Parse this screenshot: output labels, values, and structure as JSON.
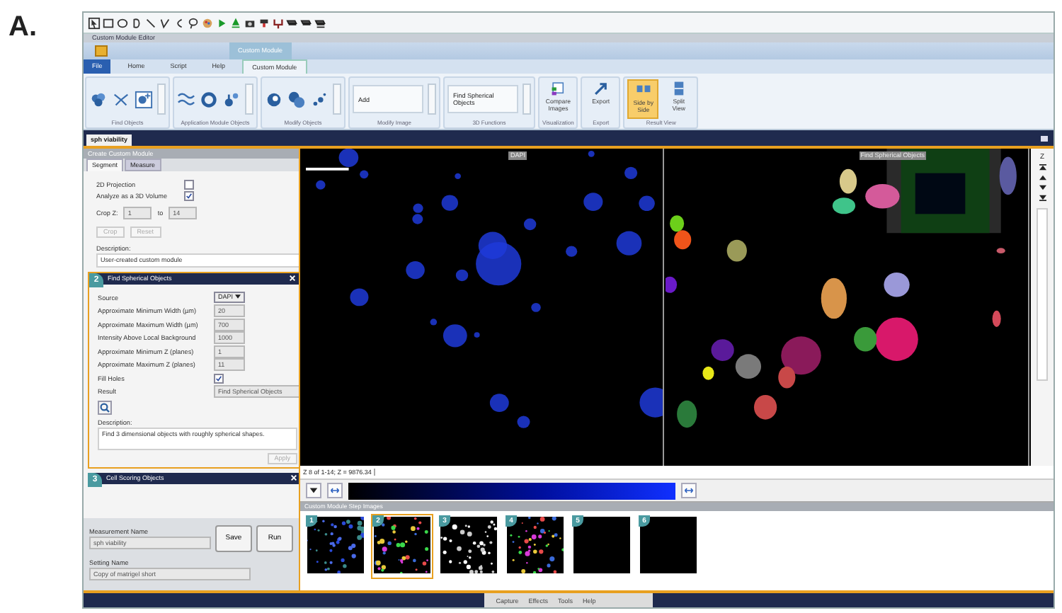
{
  "figure_label": "A.",
  "window": {
    "title": "Custom Module Editor"
  },
  "contextual_tab": {
    "label": "Custom Module"
  },
  "ribbon_tabs": [
    {
      "label": "File",
      "kind": "file",
      "selected": false
    },
    {
      "label": "Home",
      "kind": "tab",
      "selected": false
    },
    {
      "label": "Script",
      "kind": "tab",
      "selected": false
    },
    {
      "label": "Help",
      "kind": "tab",
      "selected": false
    },
    {
      "label": "Custom Module",
      "kind": "tab",
      "selected": true
    }
  ],
  "ribbon_groups": [
    {
      "label": "Find Objects",
      "kind": "icons"
    },
    {
      "label": "Application Module Objects",
      "kind": "icons"
    },
    {
      "label": "Modify Objects",
      "kind": "icons"
    },
    {
      "label": "Modify Image",
      "kind": "dropdown",
      "value": "Add"
    },
    {
      "label": "3D Functions",
      "kind": "dropdown",
      "value": "Find Spherical Objects"
    },
    {
      "label": "Visualization",
      "kind": "buttons",
      "buttons": [
        {
          "label": "Compare Images",
          "selected": false
        }
      ]
    },
    {
      "label": "Export",
      "kind": "buttons",
      "buttons": [
        {
          "label": "Export",
          "selected": false
        }
      ]
    },
    {
      "label": "Result View",
      "kind": "buttons",
      "buttons": [
        {
          "label": "Side by Side",
          "selected": true
        },
        {
          "label": "Split View",
          "selected": false
        }
      ]
    }
  ],
  "document_tab": {
    "label": "sph viability"
  },
  "module_panel": {
    "title": "Create Custom Module",
    "tabs": [
      {
        "label": "Segment",
        "selected": true
      },
      {
        "label": "Measure",
        "selected": false
      }
    ],
    "settings": [
      {
        "label": "2D Projection",
        "checked": false
      },
      {
        "label": "Analyze as a 3D Volume",
        "checked": true
      }
    ],
    "crop": {
      "label": "Crop Z:",
      "from": "1",
      "to_label": "to",
      "to": "14",
      "buttons": [
        {
          "label": "Crop",
          "disabled": true
        },
        {
          "label": "Reset",
          "disabled": true
        }
      ]
    },
    "description_label": "Description:",
    "description": "User-created custom module",
    "steps": [
      {
        "number": "2",
        "title": "Find Spherical Objects",
        "expanded": true,
        "fields": [
          {
            "kind": "dropdown",
            "label": "Source",
            "value": "DAPI"
          },
          {
            "kind": "number",
            "label": "Approximate Minimum Width (µm)",
            "value": "20"
          },
          {
            "kind": "number",
            "label": "Approximate Maximum Width (µm)",
            "value": "700"
          },
          {
            "kind": "number",
            "label": "Intensity Above Local Background",
            "value": "1000"
          },
          {
            "kind": "number",
            "label": "Approximate Minimum Z (planes)",
            "value": "1"
          },
          {
            "kind": "number",
            "label": "Approximate Maximum Z (planes)",
            "value": "11"
          },
          {
            "kind": "checkbox",
            "label": "Fill Holes",
            "checked": true
          },
          {
            "kind": "text",
            "label": "Result",
            "value": "Find Spherical Objects"
          }
        ],
        "description_label": "Description:",
        "description": "Find 3 dimensional objects with roughly spherical shapes.",
        "apply": {
          "label": "Apply",
          "disabled": true
        }
      },
      {
        "number": "3",
        "title": "Cell Scoring Objects",
        "expanded": false
      }
    ],
    "measurement_name": {
      "label": "Measurement Name",
      "value": "sph viability"
    },
    "setting_name": {
      "label": "Setting Name",
      "value": "Copy of matrigel short"
    },
    "buttons": [
      "Save",
      "Run"
    ]
  },
  "viewer": {
    "panes": [
      {
        "label": "DAPI",
        "kind": "fluorescence"
      },
      {
        "label": "Find Spherical Objects",
        "kind": "segmentation"
      }
    ],
    "z_label": "Z",
    "status": "Z 8 of 1-14; Z = 9876.34"
  },
  "step_images": {
    "title": "Custom Module Step Images",
    "thumbnails": [
      {
        "number": "1",
        "kind": "blue",
        "selected": false
      },
      {
        "number": "2",
        "kind": "mixed",
        "selected": true
      },
      {
        "number": "3",
        "kind": "white",
        "selected": false
      },
      {
        "number": "4",
        "kind": "mixed",
        "selected": false
      },
      {
        "number": "5",
        "kind": "empty",
        "selected": false
      },
      {
        "number": "6",
        "kind": "empty",
        "selected": false
      }
    ]
  },
  "menu_bar": [
    "Capture",
    "Effects",
    "Tools",
    "Help"
  ]
}
